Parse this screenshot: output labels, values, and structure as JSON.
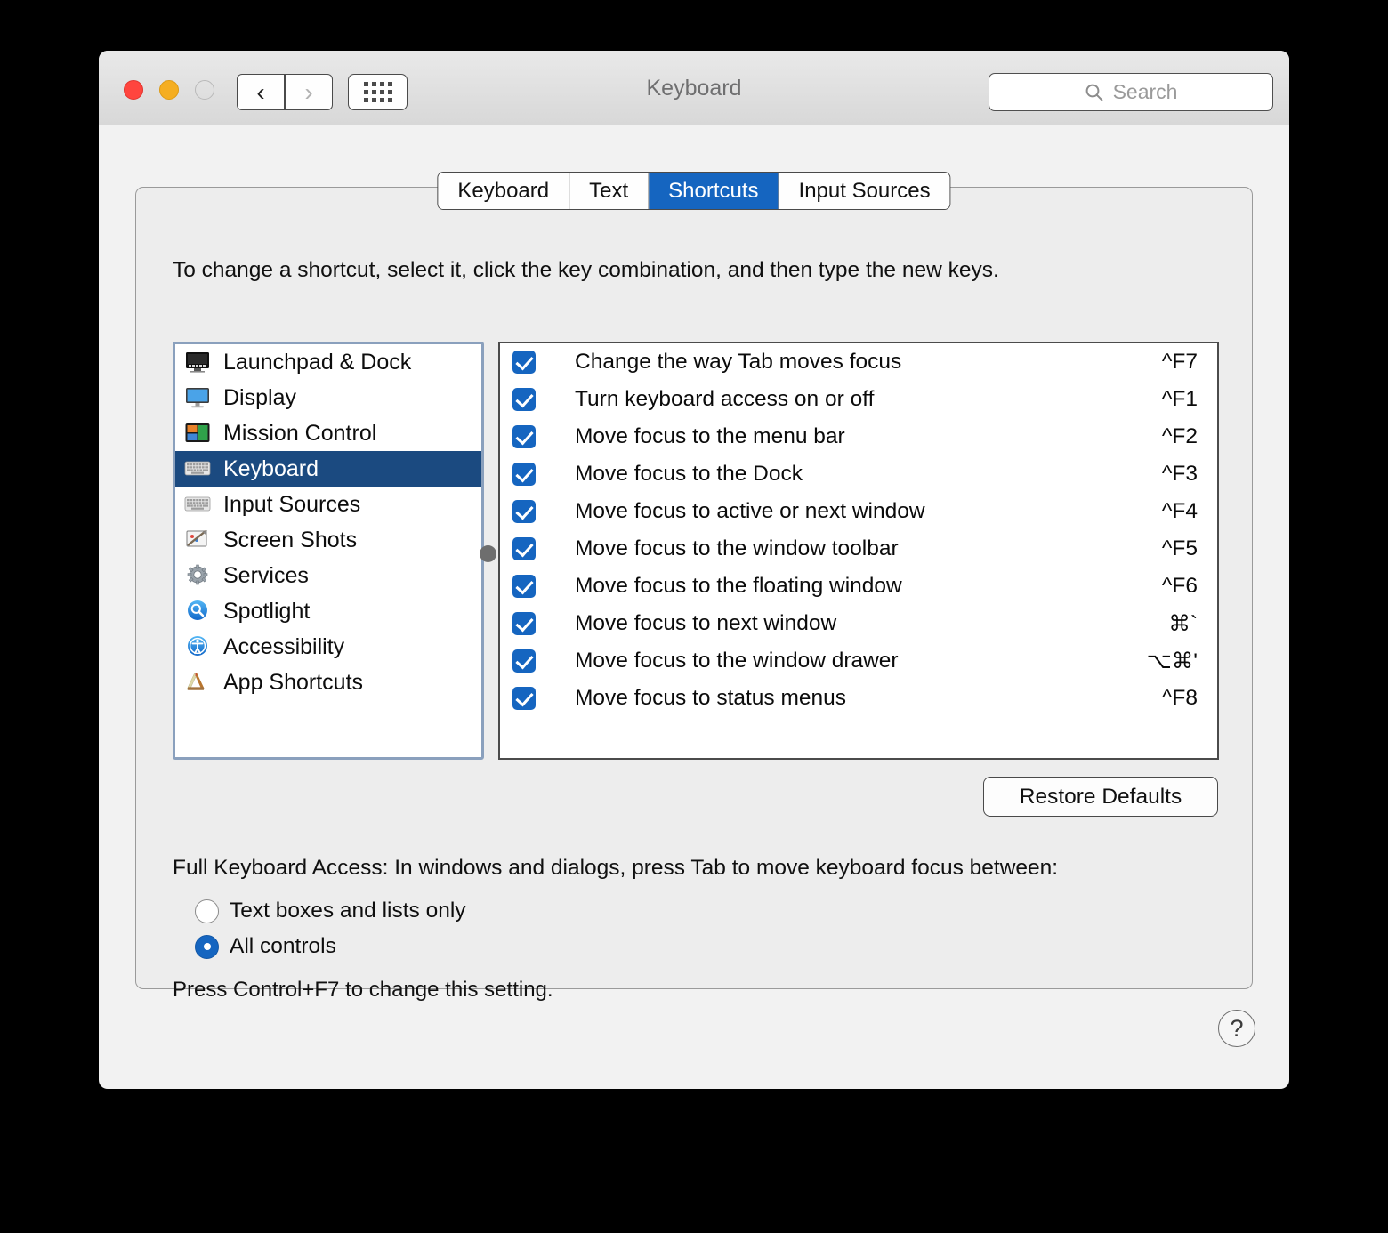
{
  "window": {
    "title": "Keyboard",
    "traffic_lights": {
      "close": "close-button",
      "minimize": "minimize-button",
      "zoom": "zoom-button"
    },
    "nav": {
      "back_icon": "‹",
      "forward_icon": "›"
    },
    "grid_button": "show-all-preferences"
  },
  "search": {
    "placeholder": "Search",
    "value": "",
    "icon": "search-icon"
  },
  "tabs": [
    {
      "label": "Keyboard",
      "active": false
    },
    {
      "label": "Text",
      "active": false
    },
    {
      "label": "Shortcuts",
      "active": true
    },
    {
      "label": "Input Sources",
      "active": false
    }
  ],
  "instruction": "To change a shortcut, select it, click the key combination, and then type the new keys.",
  "sidebar": {
    "items": [
      {
        "label": "Launchpad & Dock",
        "icon": "launchpad-dock-icon",
        "selected": false
      },
      {
        "label": "Display",
        "icon": "display-icon",
        "selected": false
      },
      {
        "label": "Mission Control",
        "icon": "mission-control-icon",
        "selected": false
      },
      {
        "label": "Keyboard",
        "icon": "keyboard-icon",
        "selected": true
      },
      {
        "label": "Input Sources",
        "icon": "input-sources-icon",
        "selected": false
      },
      {
        "label": "Screen Shots",
        "icon": "screen-shots-icon",
        "selected": false
      },
      {
        "label": "Services",
        "icon": "services-gear-icon",
        "selected": false
      },
      {
        "label": "Spotlight",
        "icon": "spotlight-icon",
        "selected": false
      },
      {
        "label": "Accessibility",
        "icon": "accessibility-icon",
        "selected": false
      },
      {
        "label": "App Shortcuts",
        "icon": "app-shortcuts-icon",
        "selected": false
      }
    ]
  },
  "shortcuts": [
    {
      "checked": true,
      "label": "Change the way Tab moves focus",
      "key": "^F7"
    },
    {
      "checked": true,
      "label": "Turn keyboard access on or off",
      "key": "^F1"
    },
    {
      "checked": true,
      "label": "Move focus to the menu bar",
      "key": "^F2"
    },
    {
      "checked": true,
      "label": "Move focus to the Dock",
      "key": "^F3"
    },
    {
      "checked": true,
      "label": "Move focus to active or next window",
      "key": "^F4"
    },
    {
      "checked": true,
      "label": "Move focus to the window toolbar",
      "key": "^F5"
    },
    {
      "checked": true,
      "label": "Move focus to the floating window",
      "key": "^F6"
    },
    {
      "checked": true,
      "label": "Move focus to next window",
      "key": "⌘`"
    },
    {
      "checked": true,
      "label": "Move focus to the window drawer",
      "key": "⌥⌘'"
    },
    {
      "checked": true,
      "label": "Move focus to status menus",
      "key": "^F8"
    }
  ],
  "restore_defaults_label": "Restore Defaults",
  "full_keyboard_access": {
    "title": "Full Keyboard Access: In windows and dialogs, press Tab to move keyboard focus between:",
    "options": [
      {
        "label": "Text boxes and lists only",
        "selected": false
      },
      {
        "label": "All controls",
        "selected": true
      }
    ],
    "note": "Press Control+F7 to change this setting."
  },
  "help_label": "?",
  "colors": {
    "accent_blue": "#1565c0",
    "selection_navy": "#1b4a80",
    "window_chrome": "#e4e4e4",
    "group_bg": "#ededed"
  }
}
